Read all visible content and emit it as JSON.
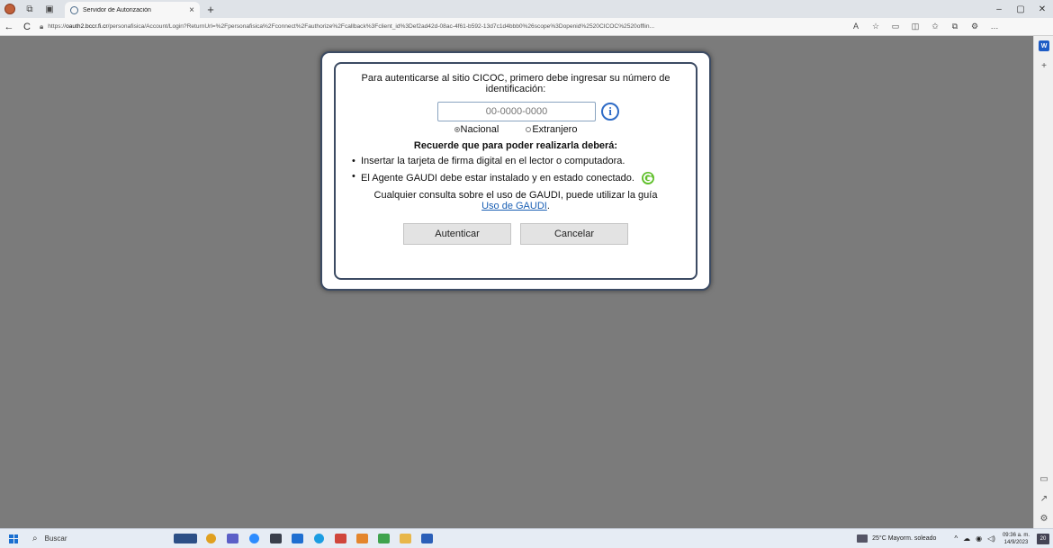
{
  "browser": {
    "tab": {
      "title": "Servidor de Autorización",
      "close": "×"
    },
    "new_tab": "+",
    "window_controls": {
      "minimize": "–",
      "restore": "▢",
      "close": "✕"
    },
    "nav": {
      "back": "←",
      "refresh": "C"
    },
    "url": {
      "scheme": "https://",
      "host": "oauth2.bccr.fi.cr",
      "path": "/personafisica/Account/Login?ReturnUrl=%2Fpersonafisica%2Fconnect%2Fauthorize%2Fcallback%3Fclient_id%3Def2ad42d-08ac-4f61-b592-13d7c1d4bbb0%26scope%3Dopenid%2520CICOC%2520offlin..."
    }
  },
  "dialog": {
    "intro": "Para autenticarse al sitio CICOC, primero debe ingresar su número de identificación:",
    "id_placeholder": "00-0000-0000",
    "radio_nacional": "Nacional",
    "radio_extranjero": "Extranjero",
    "selected_option": "Nacional",
    "remember": "Recuerde que para poder realizarla deberá:",
    "bullet_1": "Insertar la tarjeta de firma digital en el lector o computadora.",
    "bullet_2": "El Agente GAUDI debe estar instalado y en estado conectado.",
    "consult_text": "Cualquier consulta sobre el uso de GAUDI, puede utilizar la guía",
    "consult_link": "Uso de GAUDI",
    "consult_end": ".",
    "btn_auth": "Autenticar",
    "btn_cancel": "Cancelar"
  },
  "taskbar": {
    "search_label": "Buscar",
    "weather": "25°C  Mayorm. soleado",
    "time": "09:36 a. m.",
    "date": "14/9/2023",
    "notifications": "20"
  },
  "colors": {
    "accent": "#3c4b63",
    "link": "#1a5fb4",
    "page_bg": "#7b7b7b"
  }
}
